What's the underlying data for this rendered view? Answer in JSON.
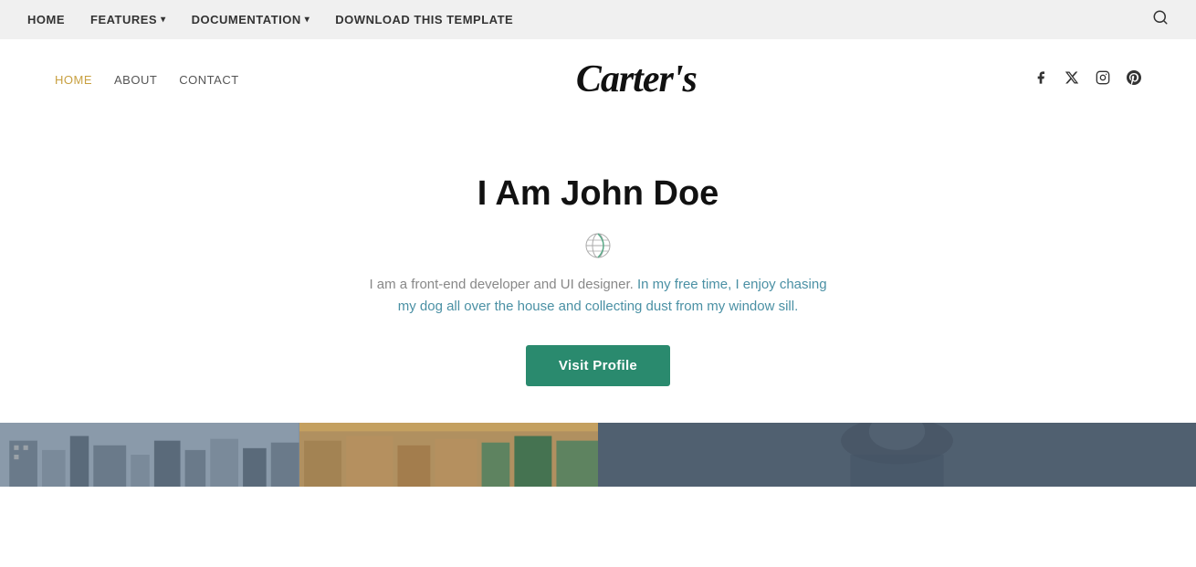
{
  "top_nav": {
    "links": [
      {
        "label": "HOME",
        "id": "home",
        "has_dropdown": false
      },
      {
        "label": "FEATURES",
        "id": "features",
        "has_dropdown": true
      },
      {
        "label": "DOCUMENTATION",
        "id": "documentation",
        "has_dropdown": true
      },
      {
        "label": "DOWNLOAD THIS TEMPLATE",
        "id": "download",
        "has_dropdown": false
      }
    ],
    "search_icon": "🔍"
  },
  "header": {
    "nav": [
      {
        "label": "HOME",
        "id": "home",
        "active": true
      },
      {
        "label": "ABOUT",
        "id": "about",
        "active": false
      },
      {
        "label": "CONTACT",
        "id": "contact",
        "active": false
      }
    ],
    "logo": "Carter's",
    "social_icons": [
      {
        "name": "facebook-icon",
        "symbol": "f",
        "label": "Facebook"
      },
      {
        "name": "twitter-x-icon",
        "symbol": "✕",
        "label": "X / Twitter"
      },
      {
        "name": "instagram-icon",
        "symbol": "◻",
        "label": "Instagram"
      },
      {
        "name": "pinterest-icon",
        "symbol": "℗",
        "label": "Pinterest"
      }
    ]
  },
  "hero": {
    "title": "I Am John Doe",
    "description_part1": "I am a front-end developer and UI designer.",
    "description_part2": " In my free time, I enjoy chasing my dog all over the house and collecting dust from my window sill.",
    "button_label": "Visit Profile"
  },
  "colors": {
    "accent_gold": "#c8a040",
    "button_green": "#2a8a6e",
    "text_highlight": "#4a90a4"
  }
}
